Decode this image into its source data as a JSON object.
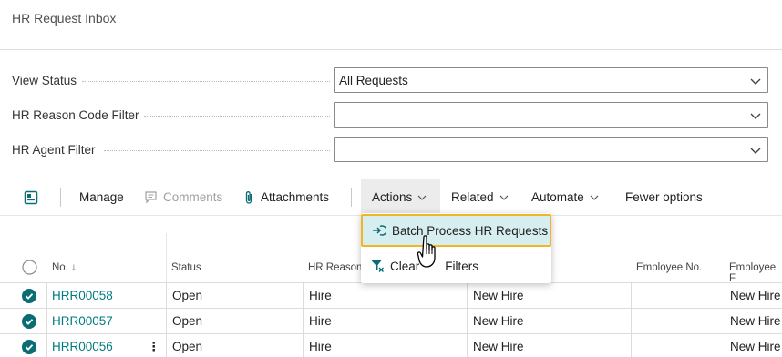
{
  "page": {
    "title": "HR Request Inbox"
  },
  "filters": [
    {
      "label": "View Status",
      "value": "All Requests"
    },
    {
      "label": "HR Reason Code Filter",
      "value": ""
    },
    {
      "label": "HR Agent Filter",
      "value": ""
    }
  ],
  "toolbar": {
    "manage": "Manage",
    "comments": "Comments",
    "attachments": "Attachments",
    "actions": "Actions",
    "related": "Related",
    "automate": "Automate",
    "fewer_options": "Fewer options"
  },
  "actions_menu": {
    "items": [
      {
        "label": "Batch Process HR Requests"
      },
      {
        "label_left": "Clear",
        "label_right": "Filters"
      }
    ]
  },
  "grid": {
    "columns": [
      "No. ↓",
      "Status",
      "HR Reason",
      "Employee No.",
      "Employee F"
    ],
    "rows": [
      {
        "no": "HRR00058",
        "status": "Open",
        "reason": "Hire",
        "description": "New Hire",
        "employee_no": "",
        "employee_name": "New Hire"
      },
      {
        "no": "HRR00057",
        "status": "Open",
        "reason": "Hire",
        "description": "New Hire",
        "employee_no": "",
        "employee_name": "New Hire"
      },
      {
        "no": "HRR00056",
        "status": "Open",
        "reason": "Hire",
        "description": "New Hire",
        "employee_no": "",
        "employee_name": "New Hire"
      }
    ],
    "row_menu_glyph": "⋮"
  },
  "colors": {
    "accent": "#0a6d73",
    "link": "#007a80",
    "highlight": "#d7eef0",
    "focus_border": "#f2b523"
  },
  "icons": [
    "layout-icon",
    "comment-icon",
    "paperclip-icon",
    "chevron-down-icon",
    "batch-process-icon",
    "clear-filter-icon",
    "hand-cursor-icon",
    "check-circle-icon"
  ]
}
